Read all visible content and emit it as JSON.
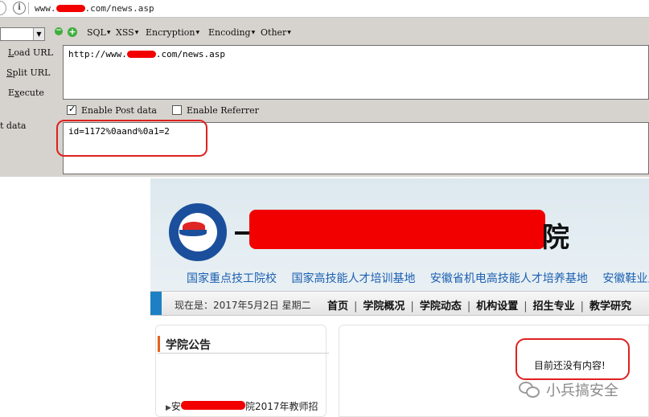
{
  "address_bar": {
    "info_symbol": "i",
    "url_prefix": "www.",
    "url_suffix": ".com/news.asp"
  },
  "hackbar": {
    "menus": [
      "SQL",
      "XSS",
      "Encryption",
      "Encoding",
      "Other"
    ],
    "minus_symbol": "−",
    "plus_symbol": "+",
    "load_url": {
      "hot": "L",
      "rest": "oad URL"
    },
    "split_url": {
      "hot": "S",
      "rest": "plit URL"
    },
    "execute": {
      "pre": "E",
      "hot": "x",
      "rest": "ecute"
    },
    "post_side_label": "t data",
    "url_text_prefix": "http://www.",
    "url_text_suffix": ".com/news.asp",
    "enable_post_label": "Enable Post data",
    "enable_post_checked": true,
    "enable_referrer_label": "Enable Referrer",
    "enable_referrer_checked": false,
    "post_data": "id=1172%0aand%0a1=2"
  },
  "page": {
    "banner_title_end": "院",
    "slogans": [
      "国家重点技工院校",
      "国家高技能人才培训基地",
      "安徽省机电高技能人才培养基地",
      "安徽鞋业人"
    ],
    "date_text": "现在是：2017年5月2日  星期二",
    "nav_links": [
      "首页",
      "学院概况",
      "学院动态",
      "机构设置",
      "招生专业",
      "教学研究"
    ],
    "notice_title": "学院公告",
    "notice_item_prefix": "安",
    "notice_item_suffix": "院2017年教师招",
    "empty_message": "目前还没有内容!",
    "watermark": "小兵搞安全"
  },
  "colors": {
    "redaction": "#f20000",
    "highlight_outline": "#e02020",
    "link_blue": "#1b5fb0",
    "nav_accent": "#1d80c4"
  }
}
